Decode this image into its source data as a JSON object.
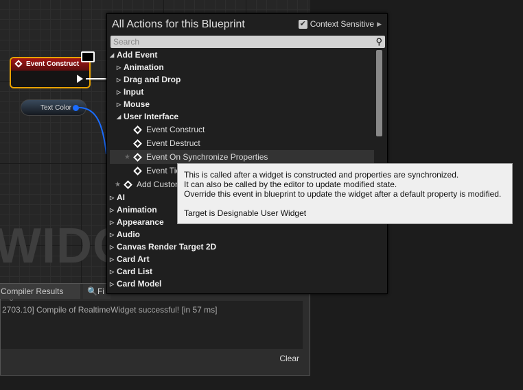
{
  "graph": {
    "watermark": "WIDGET",
    "node_title": "Event Construct",
    "variable": "Text Color"
  },
  "bottom": {
    "tabs": [
      "Compiler Results",
      "Fi"
    ],
    "log": "2703.10] Compile of RealtimeWidget successful! [in 57 ms]",
    "clear": "Clear"
  },
  "popup": {
    "title": "All Actions for this Blueprint",
    "context_sensitive": "Context Sensitive",
    "context_checked": true,
    "search_placeholder": "Search",
    "items": [
      {
        "label": "Add Event",
        "kind": "cat",
        "indent": 0,
        "open": true
      },
      {
        "label": "Animation",
        "kind": "cat",
        "indent": 1
      },
      {
        "label": "Drag and Drop",
        "kind": "cat",
        "indent": 1
      },
      {
        "label": "Input",
        "kind": "cat",
        "indent": 1
      },
      {
        "label": "Mouse",
        "kind": "cat",
        "indent": 1
      },
      {
        "label": "User Interface",
        "kind": "cat",
        "indent": 1,
        "open": true
      },
      {
        "label": "Event Construct",
        "kind": "ev",
        "indent": 2
      },
      {
        "label": "Event Destruct",
        "kind": "ev",
        "indent": 2
      },
      {
        "label": "Event On Synchronize Properties",
        "kind": "ev",
        "indent": 2,
        "selected": true
      },
      {
        "label": "Event Tick",
        "kind": "ev",
        "indent": 2
      },
      {
        "label": "Add Custom Event...",
        "kind": "ev",
        "indent": 1,
        "star": true
      },
      {
        "label": "AI",
        "kind": "cat",
        "indent": 0
      },
      {
        "label": "Animation",
        "kind": "cat",
        "indent": 0
      },
      {
        "label": "Appearance",
        "kind": "cat",
        "indent": 0
      },
      {
        "label": "Audio",
        "kind": "cat",
        "indent": 0
      },
      {
        "label": "Canvas Render Target 2D",
        "kind": "cat",
        "indent": 0
      },
      {
        "label": "Card Art",
        "kind": "cat",
        "indent": 0
      },
      {
        "label": "Card List",
        "kind": "cat",
        "indent": 0
      },
      {
        "label": "Card Model",
        "kind": "cat",
        "indent": 0
      }
    ]
  },
  "tooltip": {
    "lines": [
      "This is called after a widget is constructed and properties are synchronized.",
      "It can also be called by the editor to update modified state.",
      "Override this event in blueprint to update the widget after a default property is modified."
    ],
    "target": "Target is Designable User Widget"
  }
}
